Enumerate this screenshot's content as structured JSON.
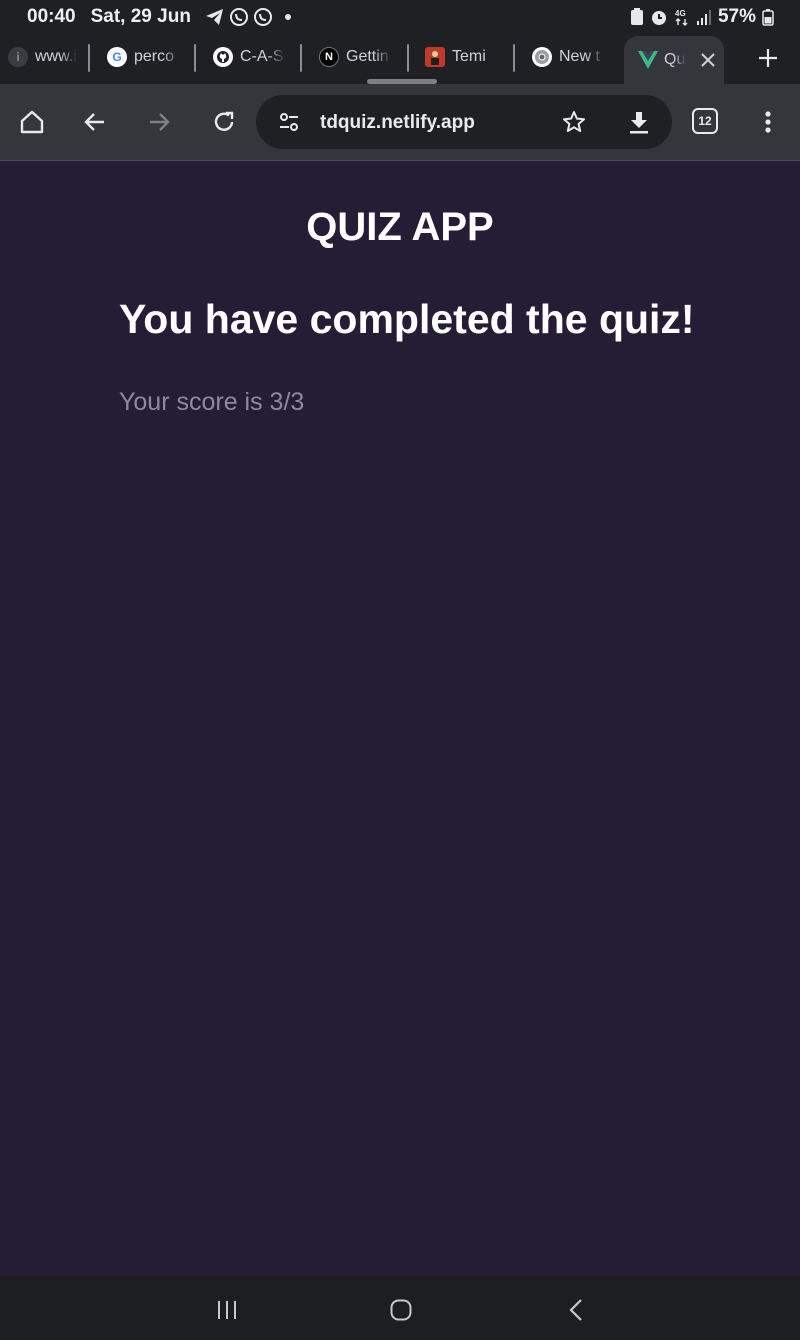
{
  "status_bar": {
    "time": "00:40",
    "date": "Sat, 29 Jun",
    "battery": "57%",
    "network": "4G"
  },
  "tabs": [
    {
      "title": "www.i",
      "favicon": "partial-icon"
    },
    {
      "title": "perco",
      "favicon": "google-icon"
    },
    {
      "title": "C-A-S",
      "favicon": "github-icon"
    },
    {
      "title": "Gettin",
      "favicon": "nextjs-icon"
    },
    {
      "title": "Temi",
      "favicon": "avatar-icon"
    },
    {
      "title": "New t",
      "favicon": "chrome-icon"
    }
  ],
  "active_tab": {
    "title": "Qu",
    "favicon": "vue-icon"
  },
  "toolbar": {
    "url": "tdquiz.netlify.app",
    "tab_count": "12"
  },
  "page": {
    "app_title": "QUIZ APP",
    "heading": "You have completed the quiz!",
    "score_text": "Your score is 3/3"
  },
  "colors": {
    "page_background": "#251d35",
    "browser_chrome": "#34363c",
    "status_bar": "#1f2024",
    "muted_text": "#8f8a9b"
  }
}
